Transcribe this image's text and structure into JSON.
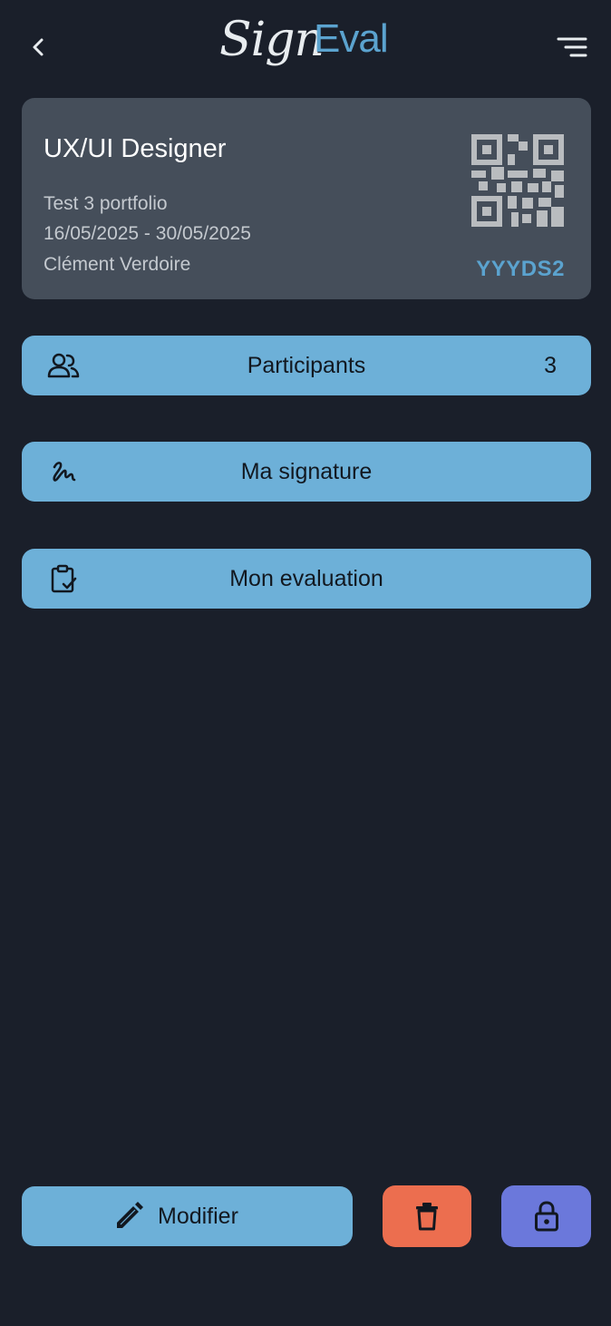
{
  "header": {
    "logo_part1": "Sign",
    "logo_part2": "Eval",
    "back_icon": "chevron-left-icon",
    "menu_icon": "menu-icon"
  },
  "session": {
    "title": "UX/UI Designer",
    "subtitle": "Test 3 portfolio",
    "dates": "16/05/2025 - 30/05/2025",
    "trainer": "Clément Verdoire",
    "code": "YYYDS2",
    "qr_icon": "qr-code-icon"
  },
  "actions": [
    {
      "label": "Participants",
      "count": "3",
      "icon": "users-icon"
    },
    {
      "label": "Ma signature",
      "icon": "signature-icon"
    },
    {
      "label": "Mon evaluation",
      "icon": "clipboard-check-icon"
    }
  ],
  "bottom": {
    "modify_label": "Modifier",
    "modify_icon": "pencil-icon",
    "delete_icon": "trash-icon",
    "lock_icon": "lock-icon"
  },
  "colors": {
    "background": "#1a1f2a",
    "card": "#454e5a",
    "accent_blue": "#6db0d8",
    "logo_blue": "#5ba3cf",
    "delete_orange": "#ec6e4f",
    "lock_purple": "#6b78db"
  }
}
